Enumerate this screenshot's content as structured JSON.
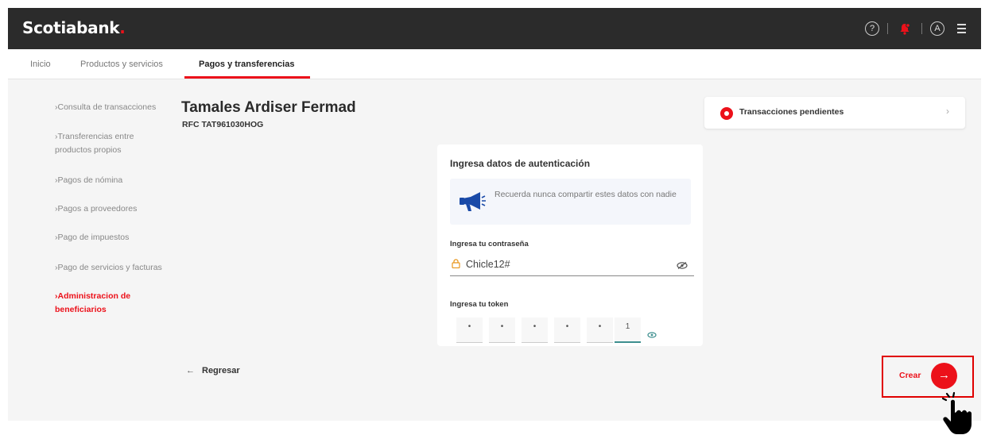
{
  "header": {
    "logo": "Scotiabank",
    "logo_dot": ".",
    "icons": [
      "help-icon",
      "notification-bell-icon",
      "user-avatar-icon",
      "menu-icon"
    ]
  },
  "nav": {
    "tabs": [
      {
        "label": "Inicio"
      },
      {
        "label": "Productos y servicios"
      },
      {
        "label": "Pagos y transferencias",
        "active": true
      }
    ]
  },
  "sidebar": {
    "items": [
      {
        "lines": [
          "Consulta de transacciones"
        ]
      },
      {
        "lines": [
          "Transferencias entre",
          "productos propios"
        ]
      },
      {
        "lines": [
          "Pagos de nómina"
        ]
      },
      {
        "lines": [
          "Pagos a proveedores"
        ]
      },
      {
        "lines": [
          "Pago de impuestos"
        ]
      },
      {
        "lines": [
          "Pago de servicios y facturas"
        ]
      },
      {
        "lines": [
          "Administracion de",
          "beneficiarios"
        ],
        "active": true
      }
    ]
  },
  "customer": {
    "name": "Tamales Ardiser Fermad",
    "rfc": "RFC TAT961030HOG"
  },
  "pending": {
    "label": "Transacciones pendientes"
  },
  "auth": {
    "title": "Ingresa datos de autenticación",
    "notice": "Recuerda nunca compartir estes datos con nadie",
    "password_label": "Ingresa tu contraseña",
    "password_value": "Chicle12#",
    "token_label": "Ingresa tu token",
    "token_digits": [
      "•",
      "•",
      "•",
      "•",
      "•",
      "1"
    ]
  },
  "actions": {
    "back_label": "Regresar",
    "back_arrow": "←",
    "create_label": "Crear",
    "create_arrow": "→"
  },
  "colors": {
    "brand_red": "#ec111a",
    "header_bg": "#2b2b2b",
    "highlight_box": "#e00000",
    "token_active": "#3e8f8f"
  }
}
